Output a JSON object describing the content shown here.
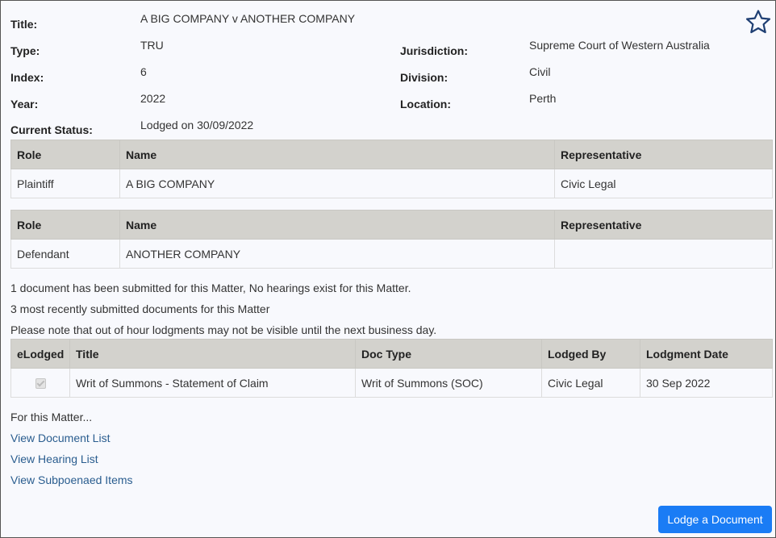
{
  "matter": {
    "title_label": "Title:",
    "title_value": "A BIG COMPANY v ANOTHER COMPANY",
    "type_label": "Type:",
    "type_value": "TRU",
    "index_label": "Index:",
    "index_value": "6",
    "year_label": "Year:",
    "year_value": "2022",
    "status_label": "Current Status:",
    "status_value": "Lodged on 30/09/2022",
    "jurisdiction_label": "Jurisdiction:",
    "jurisdiction_value": "Supreme Court of Western Australia",
    "division_label": "Division:",
    "division_value": "Civil",
    "location_label": "Location:",
    "location_value": "Perth"
  },
  "parties": {
    "headers": {
      "role": "Role",
      "name": "Name",
      "representative": "Representative"
    },
    "plaintiff": {
      "role": "Plaintiff",
      "name": "A BIG COMPANY",
      "representative": "Civic Legal"
    },
    "defendant": {
      "role": "Defendant",
      "name": "ANOTHER COMPANY",
      "representative": ""
    }
  },
  "notes": {
    "summary": "1 document has been submitted for this Matter, No hearings exist for this Matter.",
    "recent": "3 most recently submitted documents for this Matter",
    "lodgment_notice": "Please note that out of hour lodgments may not be visible until the next business day."
  },
  "documents": {
    "headers": {
      "elodged": "eLodged",
      "title": "Title",
      "doc_type": "Doc Type",
      "lodged_by": "Lodged By",
      "lodgment_date": "Lodgment Date"
    },
    "rows": [
      {
        "elodged": true,
        "title": "Writ of Summons - Statement of Claim",
        "doc_type": "Writ of Summons (SOC)",
        "lodged_by": "Civic Legal",
        "lodgment_date": "30 Sep 2022"
      }
    ]
  },
  "links": {
    "heading": "For this Matter...",
    "document_list": "View Document List",
    "hearing_list": "View Hearing List",
    "subpoenaed_items": "View Subpoenaed Items"
  },
  "actions": {
    "lodge_document": "Lodge a Document"
  },
  "icons": {
    "favourite": "star-outline-icon"
  },
  "colors": {
    "link": "#2a5d8f",
    "primary_button": "#1a7cf5",
    "table_header": "#d3d2cd",
    "star": "#1f3f73"
  }
}
